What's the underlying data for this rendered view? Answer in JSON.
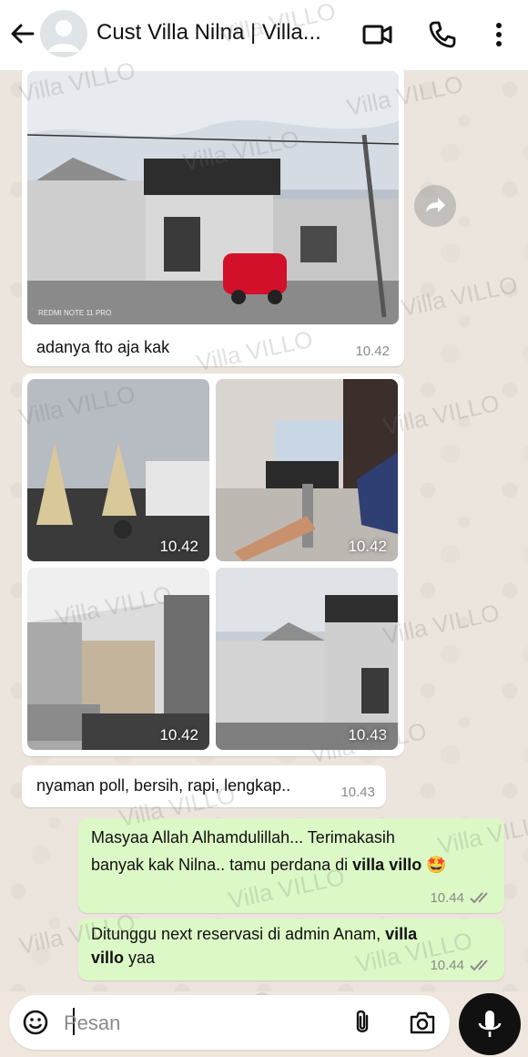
{
  "header": {
    "title": "Cust Villa Nilna | Villa...",
    "icons": [
      "back-arrow-icon",
      "avatar-icon",
      "video-call-icon",
      "phone-call-icon",
      "more-options-icon"
    ]
  },
  "messages": {
    "m1": {
      "caption": "adanya fto aja kak",
      "time": "10.42",
      "photo_label": "REDMI NOTE 11 PRO"
    },
    "album": {
      "times": [
        "10.42",
        "10.42",
        "10.42",
        "10.43"
      ]
    },
    "m2": {
      "text": "nyaman poll, bersih, rapi, lengkap..",
      "time": "10.43"
    },
    "m3": {
      "line1": "Masyaa Allah Alhamdulillah... Terimakasih",
      "line2_pre": "banyak kak Nilna.. tamu perdana di ",
      "line2_bold": "villa villo",
      "emoji": "🤩",
      "time": "10.44"
    },
    "m4": {
      "line1_pre": "Ditunggu next reservasi di admin Anam, ",
      "line1_bold": "villa",
      "line2_bold": "villo",
      "line2_post": " yaa",
      "time": "10.44"
    }
  },
  "input": {
    "placeholder": "Pesan"
  },
  "watermark": "Villa VILLO",
  "colors": {
    "outgoing_bubble": "#dcf8c6",
    "incoming_bubble": "#ffffff",
    "read_ticks": "#8a8a8a"
  }
}
